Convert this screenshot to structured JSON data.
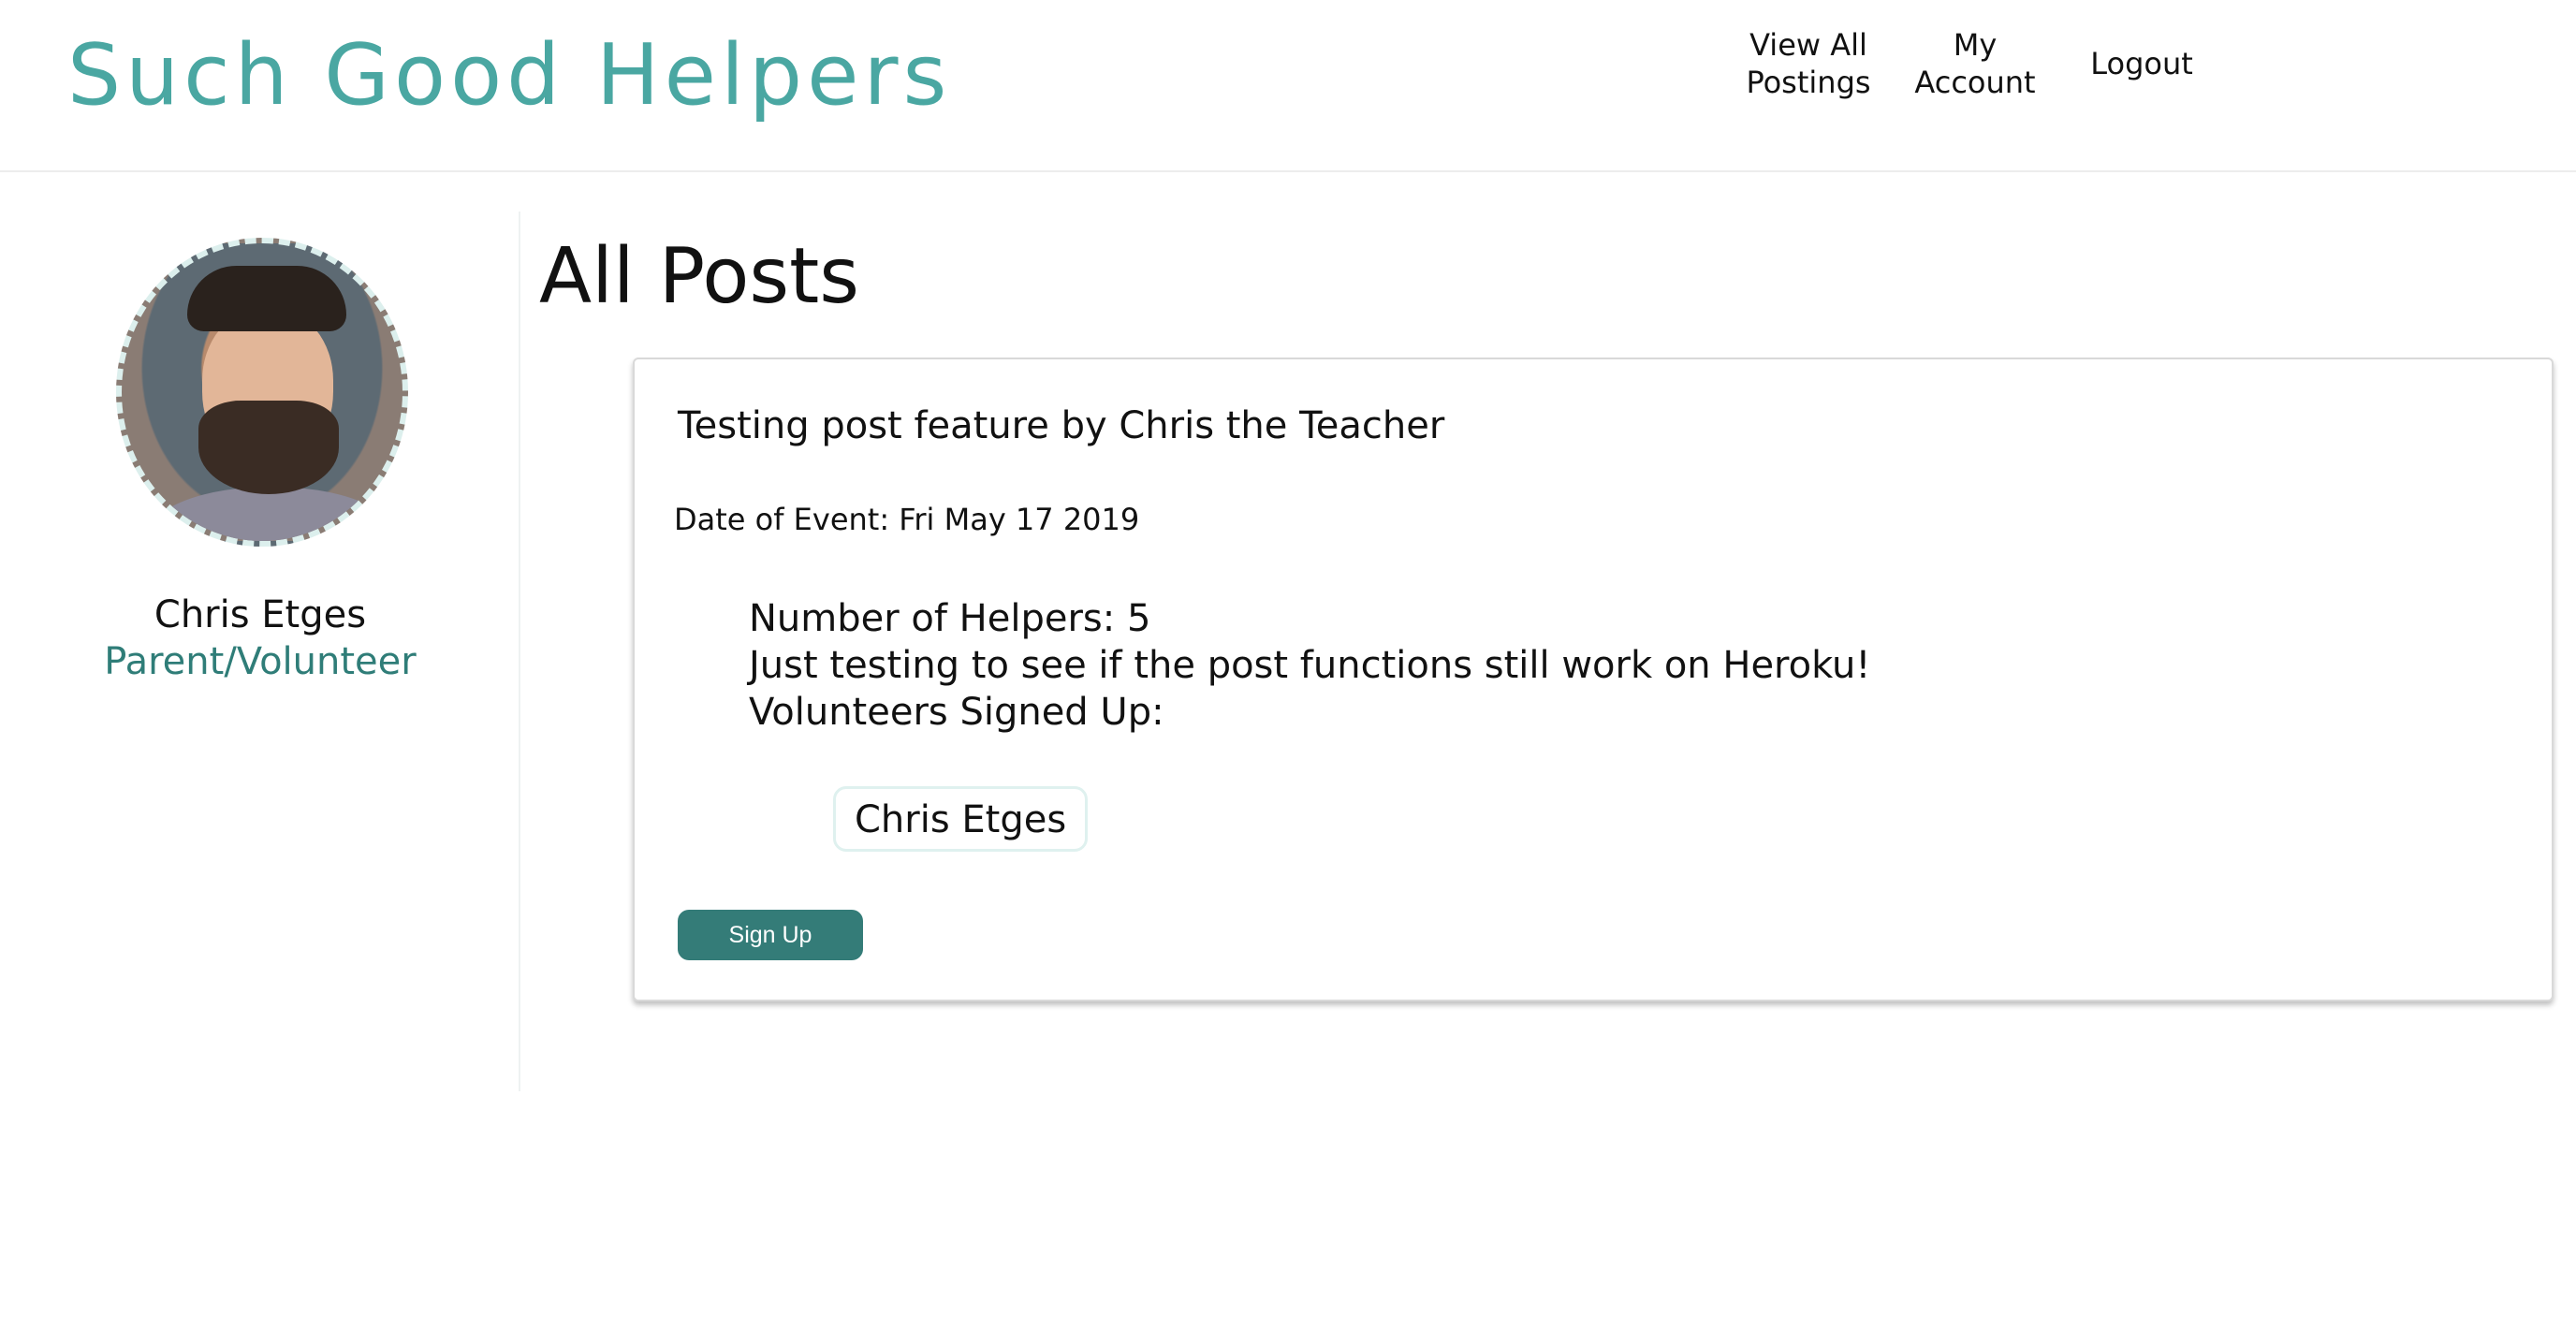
{
  "header": {
    "brand": "Such Good Helpers",
    "nav": {
      "view_all": "View All\nPostings",
      "my_account": "My\nAccount",
      "logout": "Logout"
    }
  },
  "sidebar": {
    "user_name": "Chris Etges",
    "user_role": "Parent/Volunteer"
  },
  "main": {
    "title": "All Posts",
    "posts": [
      {
        "title": "Testing post feature by Chris the Teacher",
        "date_line": "Date of Event: Fri May 17 2019",
        "helpers_line": "Number of Helpers: 5",
        "description": "Just testing to see if the post functions still work on Heroku!",
        "volunteers_label": "Volunteers Signed Up:",
        "volunteers": [
          "Chris Etges"
        ],
        "signup_label": "Sign Up"
      }
    ]
  },
  "colors": {
    "brand": "#4aa7a2",
    "role": "#2f7d78",
    "button": "#347c78"
  }
}
